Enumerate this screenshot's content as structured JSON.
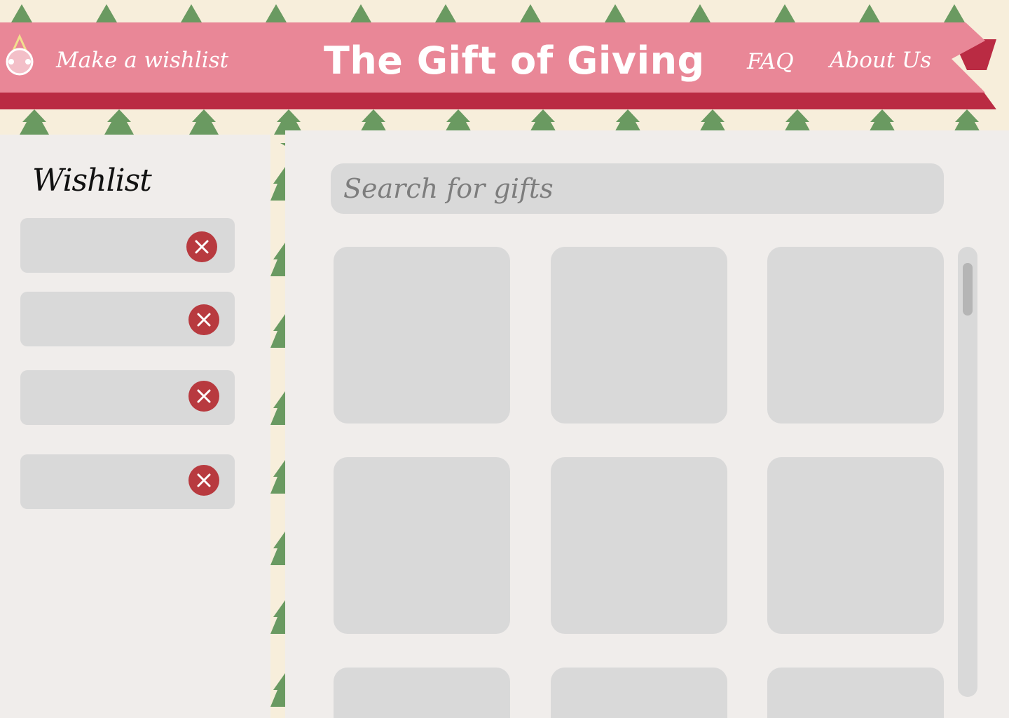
{
  "header": {
    "make_wishlist_label": "Make a wishlist",
    "title": "The Gift of Giving",
    "nav": [
      {
        "label": "FAQ"
      },
      {
        "label": "About Us"
      }
    ]
  },
  "sidebar": {
    "title": "Wishlist",
    "remove_label": "✕"
  },
  "search": {
    "placeholder": "Search for gifts"
  },
  "colors": {
    "banner_pink": "#e98797",
    "banner_red": "#ba2b43",
    "tree_green": "#6a9a61",
    "remove_red": "#b83a3f",
    "panel": "#f0edeb",
    "tile": "#d9d9d9"
  },
  "icons": {
    "logo": "ornament-icon",
    "remove": "close-icon"
  }
}
